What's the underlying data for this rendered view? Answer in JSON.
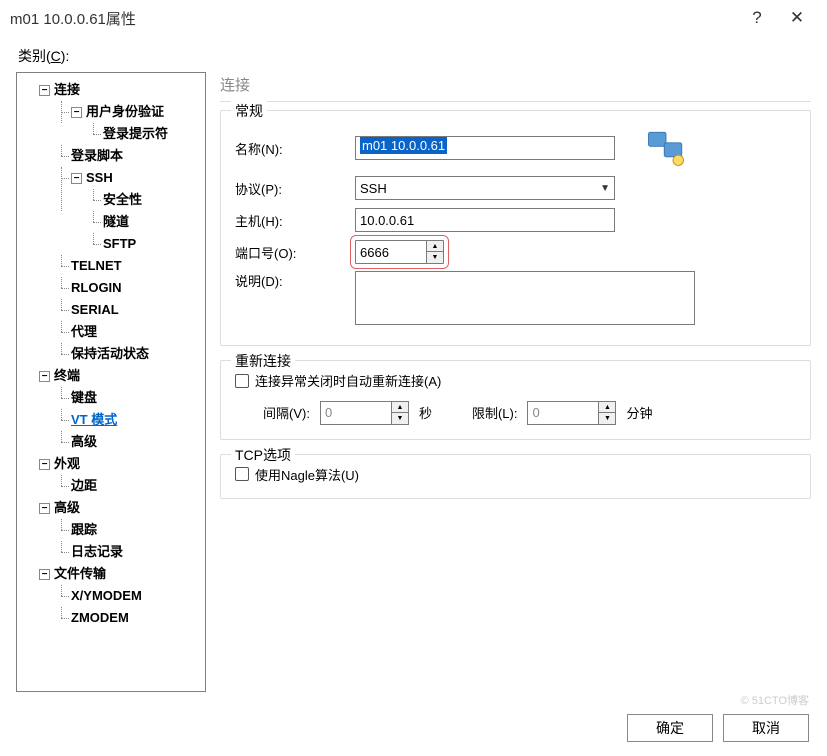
{
  "title": "m01  10.0.0.61属性",
  "category_label": "类别(",
  "category_key": "C",
  "category_label_end": "):",
  "tree": {
    "connection": "连接",
    "user_auth": "用户身份验证",
    "login_prompt": "登录提示符",
    "login_script": "登录脚本",
    "ssh": "SSH",
    "security": "安全性",
    "tunnel": "隧道",
    "sftp": "SFTP",
    "telnet": "TELNET",
    "rlogin": "RLOGIN",
    "serial": "SERIAL",
    "proxy": "代理",
    "keepalive": "保持活动状态",
    "terminal": "终端",
    "keyboard": "键盘",
    "vt_mode": "VT 模式",
    "advanced_term": "高级",
    "appearance": "外观",
    "margin": "边距",
    "advanced": "高级",
    "trace": "跟踪",
    "logging": "日志记录",
    "file_transfer": "文件传输",
    "xymodem": "X/YMODEM",
    "zmodem": "ZMODEM"
  },
  "panel": {
    "header": "连接",
    "general": {
      "title": "常规",
      "name_label": "名称(N):",
      "name_value": "m01  10.0.0.61",
      "protocol_label": "协议(P):",
      "protocol_value": "SSH",
      "host_label": "主机(H):",
      "host_value": "10.0.0.61",
      "port_label": "端口号(O):",
      "port_value": "6666",
      "desc_label": "说明(D):"
    },
    "reconnect": {
      "title": "重新连接",
      "checkbox": "连接异常关闭时自动重新连接(A)",
      "interval_label": "间隔(V):",
      "interval_value": "0",
      "interval_unit": "秒",
      "limit_label": "限制(L):",
      "limit_value": "0",
      "limit_unit": "分钟"
    },
    "tcp": {
      "title": "TCP选项",
      "nagle": "使用Nagle算法(U)"
    }
  },
  "buttons": {
    "ok": "确定",
    "cancel": "取消"
  },
  "watermark": "© 51CTO博客"
}
